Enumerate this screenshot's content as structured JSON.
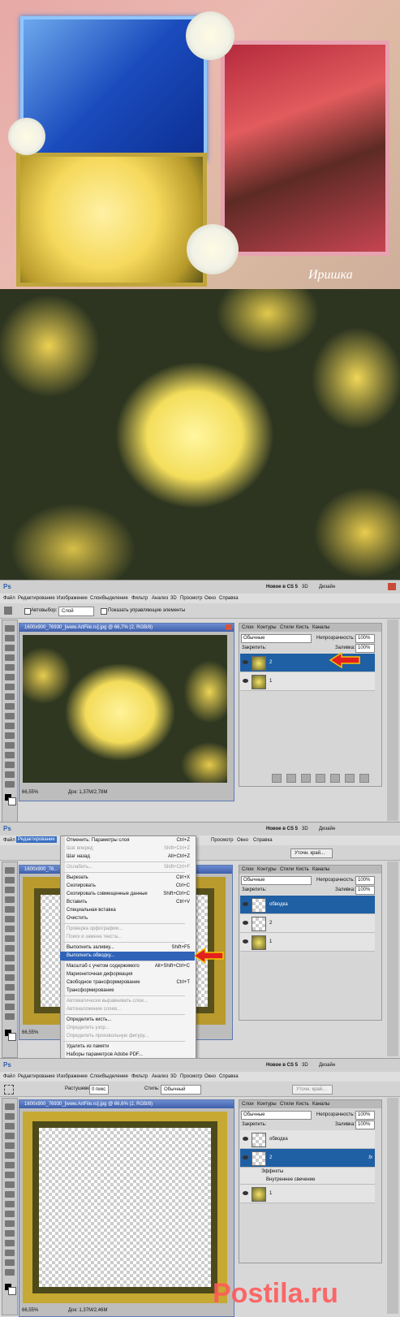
{
  "collage": {
    "signature": "Иришка"
  },
  "screen1": {
    "topbar_right": [
      "Новое в CS 5",
      "3D",
      "Дизайн"
    ],
    "menu": [
      "Файл",
      "Редактирование",
      "Изображение",
      "Слои",
      "Выделение",
      "Фильтр",
      "Анализ",
      "3D",
      "Просмотр",
      "Окно",
      "Справка"
    ],
    "options": {
      "autoselect_label": "Автовыбор:",
      "autoselect_value": "Слой",
      "transform_label": "Показать управляющие элементы"
    },
    "doc_title": "1600x900_76930_[www.ArtFile.ru].jpg @ 66,7% (2, RGB/8)",
    "status": {
      "zoom": "66,55%",
      "doc": "Док: 1,37M/2,78M"
    },
    "panel_tabs": [
      "Слои",
      "Контуры",
      "Стили",
      "Кисть",
      "Каналы"
    ],
    "blend_mode": "Обычные",
    "opacity_label": "Непрозрачность:",
    "opacity_value": "100%",
    "lock_label": "Закрепить:",
    "fill_label": "Заливка:",
    "fill_value": "100%",
    "layers": [
      {
        "name": "2"
      },
      {
        "name": "1"
      }
    ]
  },
  "screen2": {
    "topbar_right": [
      "Новое в CS 5",
      "3D",
      "Дизайн"
    ],
    "menu": [
      "Файл",
      "Редактирование",
      "Изображение",
      "Слои",
      "Выделение",
      "Фильтр",
      "Анализ",
      "3D",
      "Просмотр",
      "Окно",
      "Справка"
    ],
    "refine_button": "Уточн. край...",
    "doc_title": "1600x900_76...",
    "status_zoom": "66,55%",
    "menu_items": [
      {
        "label": "Отменить: Параметры слоя",
        "shortcut": "Ctrl+Z",
        "disabled": false
      },
      {
        "label": "Шаг вперед",
        "shortcut": "Shift+Ctrl+Z",
        "disabled": true
      },
      {
        "label": "Шаг назад",
        "shortcut": "Alt+Ctrl+Z",
        "disabled": false
      },
      {
        "label": "Ослабить...",
        "shortcut": "Shift+Ctrl+F",
        "disabled": true
      },
      {
        "label": "Вырезать",
        "shortcut": "Ctrl+X",
        "disabled": false
      },
      {
        "label": "Скопировать",
        "shortcut": "Ctrl+C",
        "disabled": false
      },
      {
        "label": "Скопировать совмещенные данные",
        "shortcut": "Shift+Ctrl+C",
        "disabled": false
      },
      {
        "label": "Вставить",
        "shortcut": "Ctrl+V",
        "disabled": false
      },
      {
        "label": "Специальная вставка",
        "shortcut": "",
        "disabled": false
      },
      {
        "label": "Очистить",
        "shortcut": "",
        "disabled": false
      },
      {
        "label": "Проверка орфографии...",
        "shortcut": "",
        "disabled": true
      },
      {
        "label": "Поиск и замена текста...",
        "shortcut": "",
        "disabled": true
      },
      {
        "label": "Выполнить заливку...",
        "shortcut": "Shift+F5",
        "disabled": false
      },
      {
        "label": "Выполнить обводку...",
        "shortcut": "",
        "disabled": false,
        "highlighted": true
      },
      {
        "label": "Масштаб с учетом содержимого",
        "shortcut": "Alt+Shift+Ctrl+C",
        "disabled": false
      },
      {
        "label": "Марионеточная деформация",
        "shortcut": "",
        "disabled": false
      },
      {
        "label": "Свободное трансформирование",
        "shortcut": "Ctrl+T",
        "disabled": false
      },
      {
        "label": "Трансформирование",
        "shortcut": "",
        "disabled": false
      },
      {
        "label": "Автоматически выравнивать слои...",
        "shortcut": "",
        "disabled": true
      },
      {
        "label": "Автоналожение слоев...",
        "shortcut": "",
        "disabled": true
      },
      {
        "label": "Определить кисть...",
        "shortcut": "",
        "disabled": false
      },
      {
        "label": "Определить узор...",
        "shortcut": "",
        "disabled": true
      },
      {
        "label": "Определить произвольную фигуру...",
        "shortcut": "",
        "disabled": true
      },
      {
        "label": "Удалить из памяти",
        "shortcut": "",
        "disabled": false
      },
      {
        "label": "Наборы параметров Adobe PDF...",
        "shortcut": "",
        "disabled": false
      }
    ],
    "panel_tabs": [
      "Слои",
      "Контуры",
      "Стили",
      "Кисть",
      "Каналы"
    ],
    "blend_mode": "Обычные",
    "opacity_label": "Непрозрачность:",
    "opacity_value": "100%",
    "lock_label": "Закрепить:",
    "fill_label": "Заливка:",
    "fill_value": "100%",
    "layers": [
      {
        "name": "обводка"
      },
      {
        "name": "2"
      },
      {
        "name": "1"
      }
    ]
  },
  "screen3": {
    "topbar_right": [
      "Новое в CS 5",
      "3D",
      "Дизайн"
    ],
    "menu": [
      "Файл",
      "Редактирование",
      "Изображение",
      "Слои",
      "Выделение",
      "Фильтр",
      "Анализ",
      "3D",
      "Просмотр",
      "Окно",
      "Справка"
    ],
    "options": {
      "feather_label": "Растушевка:",
      "feather_value": "0 пикс",
      "style_label": "Стиль:",
      "style_value": "Обычный",
      "refine_button": "Уточн. край..."
    },
    "doc_title": "1600x900_76930_[www.ArtFile.ru].jpg @ 66,6% (2, RGB/8)",
    "status": {
      "zoom": "66,55%",
      "doc": "Док: 1,37M/2,46M"
    },
    "panel_tabs": [
      "Слои",
      "Контуры",
      "Стили",
      "Кисть",
      "Каналы"
    ],
    "blend_mode": "Обычные",
    "opacity_label": "Непрозрачность:",
    "opacity_value": "100%",
    "lock_label": "Закрепить:",
    "fill_label": "Заливка:",
    "fill_value": "100%",
    "layers": [
      {
        "name": "обводка"
      },
      {
        "name": "2"
      },
      {
        "name": "1"
      }
    ],
    "effects_label": "Эффекты",
    "effect_item": "Внутреннее свечение",
    "watermark": "Postila.ru"
  }
}
